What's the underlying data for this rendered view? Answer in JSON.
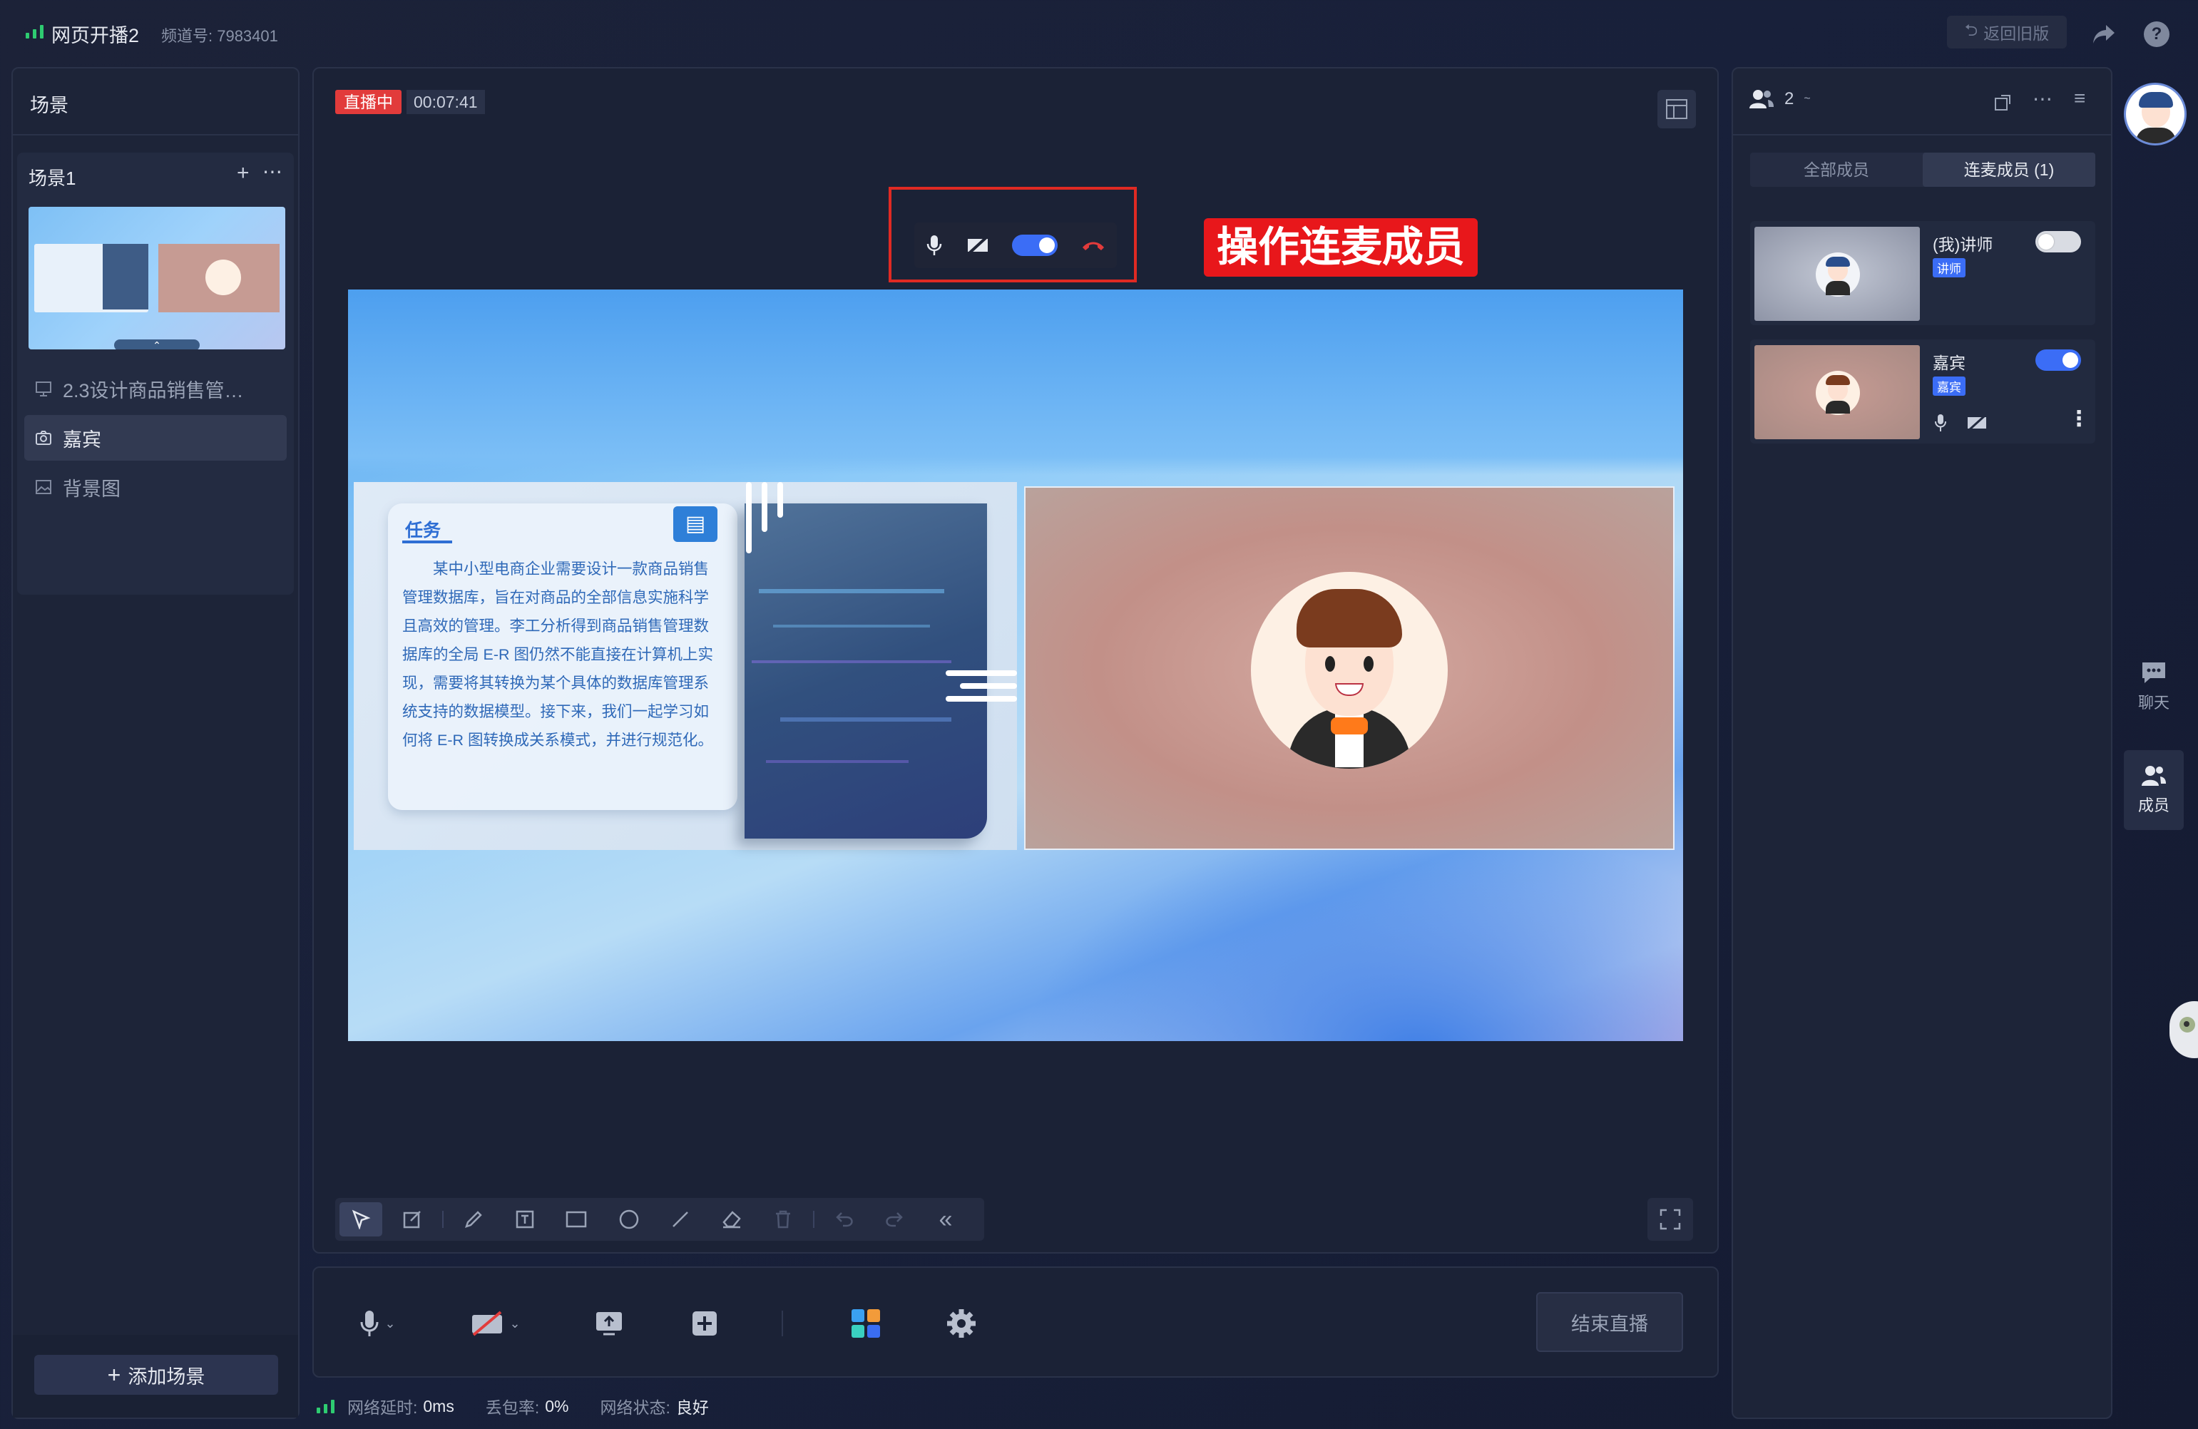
{
  "topbar": {
    "title": "网页开播2",
    "channel": "频道号: 7983401",
    "back_old": "返回旧版"
  },
  "scenes": {
    "panel_title": "场景",
    "scene_name": "场景1",
    "items": [
      {
        "label": "2.3设计商品销售管…",
        "icon": "presentation-icon"
      },
      {
        "label": "嘉宾",
        "icon": "camera-icon"
      },
      {
        "label": "背景图",
        "icon": "image-icon"
      }
    ],
    "add_scene": "添加场景"
  },
  "stage": {
    "live_badge": "直播中",
    "timer": "00:07:41",
    "annotation": "操作连麦成员",
    "slide": {
      "heading": "任务",
      "body": "某中小型电商企业需要设计一款商品销售管理数据库，旨在对商品的全部信息实施科学且高效的管理。李工分析得到商品销售管理数据库的全局 E-R 图仍然不能直接在计算机上实现，需要将其转换为某个具体的数据库管理系统支持的数据模型。接下来，我们一起学习如何将 E-R 图转换成关系模式，并进行规范化。"
    }
  },
  "toolbar": {
    "tools": [
      "select-icon",
      "edit-icon",
      "pencil-icon",
      "text-icon",
      "rectangle-icon",
      "circle-icon",
      "line-icon",
      "eraser-icon",
      "trash-icon",
      "undo-icon",
      "redo-icon",
      "collapse-icon"
    ]
  },
  "controls": {
    "end_live": "结束直播"
  },
  "status": {
    "latency_label": "网络延时:",
    "latency_value": "0ms",
    "loss_label": "丢包率:",
    "loss_value": "0%",
    "net_label": "网络状态:",
    "net_value": "良好"
  },
  "members": {
    "count": "2",
    "tab_all": "全部成员",
    "tab_linked": "连麦成员 (1)",
    "list": [
      {
        "name": "(我)讲师",
        "role": "讲师",
        "mic_on": false
      },
      {
        "name": "嘉宾",
        "role": "嘉宾",
        "mic_on": true
      }
    ]
  },
  "rail": {
    "chat": "聊天",
    "members": "成员"
  },
  "colors": {
    "accent": "#3b6df6",
    "live_red": "#e23b3b",
    "signal_green": "#2ecc71"
  }
}
